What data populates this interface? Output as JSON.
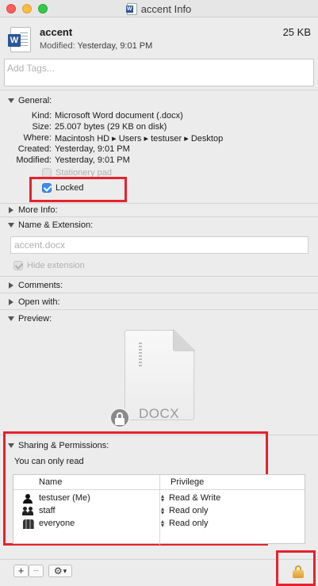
{
  "window": {
    "title": "accent Info"
  },
  "header": {
    "file_name": "accent",
    "file_size": "25 KB",
    "modified_label": "Modified:",
    "modified_value": "Yesterday, 9:01 PM"
  },
  "tags": {
    "placeholder": "Add Tags..."
  },
  "general": {
    "title": "General:",
    "rows": [
      {
        "key": "Kind:",
        "value": "Microsoft Word document (.docx)"
      },
      {
        "key": "Size:",
        "value": "25.007 bytes (29 KB on disk)"
      },
      {
        "key": "Where:",
        "value": "Macintosh HD ▸ Users ▸ testuser ▸ Desktop"
      },
      {
        "key": "Created:",
        "value": "Yesterday, 9:01 PM"
      },
      {
        "key": "Modified:",
        "value": "Yesterday, 9:01 PM"
      }
    ],
    "stationery_label": "Stationery pad",
    "stationery_checked": false,
    "locked_label": "Locked",
    "locked_checked": true
  },
  "more_info": {
    "title": "More Info:"
  },
  "name_extension": {
    "title": "Name & Extension:",
    "value": "accent.docx",
    "hide_extension_label": "Hide extension",
    "hide_extension_checked": true
  },
  "comments": {
    "title": "Comments:"
  },
  "open_with": {
    "title": "Open with:"
  },
  "preview": {
    "title": "Preview:",
    "extension": "DOCX"
  },
  "sharing": {
    "title": "Sharing & Permissions:",
    "status": "You can only read",
    "columns": {
      "name": "Name",
      "privilege": "Privilege"
    },
    "rows": [
      {
        "name": "testuser (Me)",
        "privilege": "Read & Write",
        "icon": "user-icon"
      },
      {
        "name": "staff",
        "privilege": "Read only",
        "icon": "group-icon"
      },
      {
        "name": "everyone",
        "privilege": "Read only",
        "icon": "everyone-icon"
      }
    ]
  },
  "toolbar": {
    "add_symbol": "+",
    "remove_symbol": "−",
    "action_symbol": "⚙",
    "action_chevron": "▾"
  },
  "colors": {
    "highlight": "#e5222c",
    "accent": "#3b8cf2"
  }
}
